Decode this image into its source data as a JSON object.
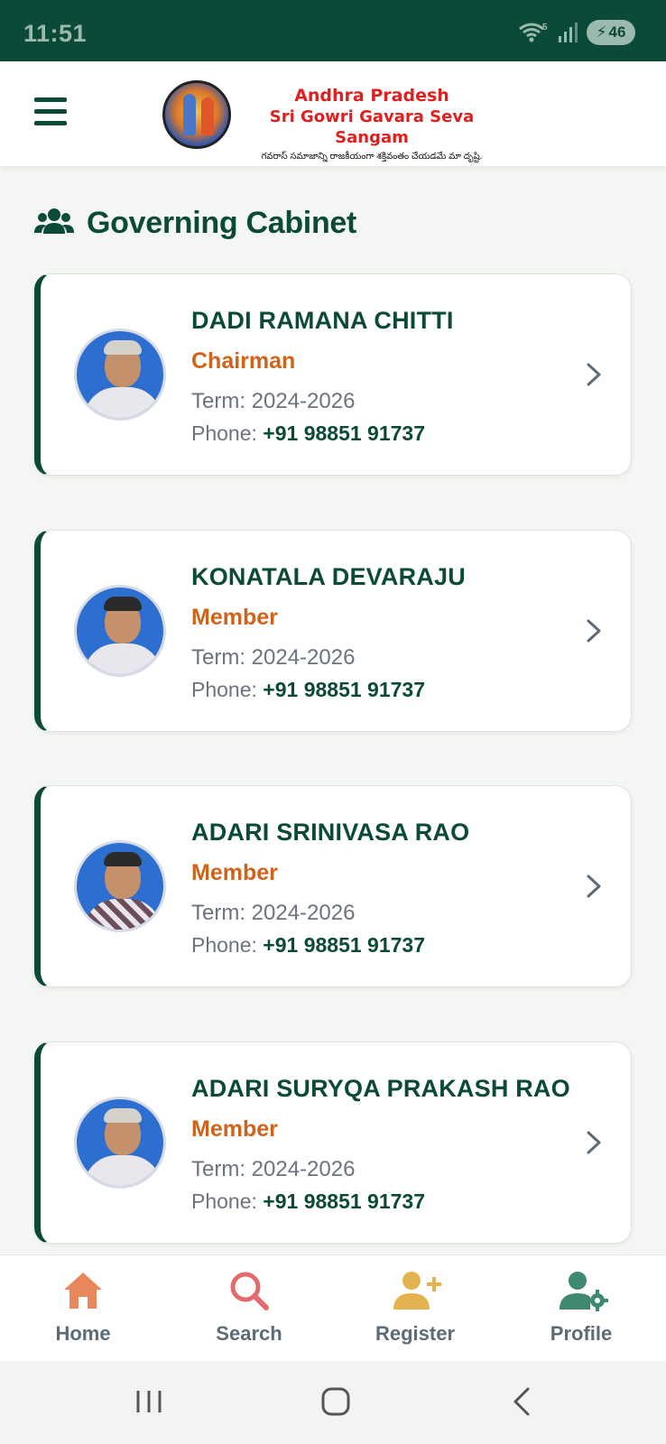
{
  "status_bar": {
    "time": "11:51",
    "battery": "46",
    "wifi_badge": "5"
  },
  "header": {
    "logo_line1": "Andhra Pradesh",
    "logo_line2": "Sri Gowri Gavara Seva Sangam",
    "logo_tagline": "గవరాస్ సమాజాన్ని రాజకీయంగా శక్తివంతం చేయడమే మా దృష్టి."
  },
  "section": {
    "title": "Governing Cabinet"
  },
  "phone_label": "Phone:",
  "members": [
    {
      "name": "DADI RAMANA CHITTI",
      "role": "Chairman",
      "term": "Term: 2024-2026",
      "phone": "+91 98851 91737"
    },
    {
      "name": "KONATALA DEVARAJU",
      "role": "Member",
      "term": "Term: 2024-2026",
      "phone": "+91 98851 91737"
    },
    {
      "name": "ADARI SRINIVASA RAO",
      "role": "Member",
      "term": "Term: 2024-2026",
      "phone": "+91 98851 91737"
    },
    {
      "name": "ADARI SURYQA PRAKASH RAO",
      "role": "Member",
      "term": "Term: 2024-2026",
      "phone": "+91 98851 91737"
    }
  ],
  "bottom_nav": {
    "items": [
      {
        "label": "Home",
        "icon": "home-icon",
        "color": "#e8875a"
      },
      {
        "label": "Search",
        "icon": "search-icon",
        "color": "#e26b6b"
      },
      {
        "label": "Register",
        "icon": "add-user-icon",
        "color": "#e2b24e"
      },
      {
        "label": "Profile",
        "icon": "user-settings-icon",
        "color": "#3f8a6e"
      }
    ]
  },
  "colors": {
    "primary": "#0b4a38",
    "accent": "#d0631a",
    "background": "#f4f6f3"
  }
}
